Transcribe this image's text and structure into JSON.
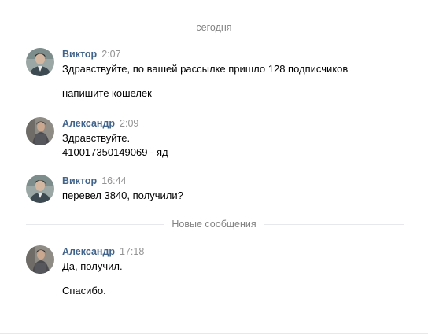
{
  "date_separator": "сегодня",
  "new_messages_separator": "Новые сообщения",
  "messages": [
    {
      "author": "Виктор",
      "time": "2:07",
      "lines": [
        "Здравствуйте, по вашей рассылке пришло 128 подписчиков",
        "напишите кошелек"
      ]
    },
    {
      "author": "Александр",
      "time": "2:09",
      "lines": [
        "Здравствуйте.",
        "410017350149069 - яд"
      ]
    },
    {
      "author": "Виктор",
      "time": "16:44",
      "lines": [
        "перевел 3840, получили?"
      ]
    },
    {
      "author": "Александр",
      "time": "17:18",
      "lines": [
        "Да, получил.",
        "Спасибо."
      ]
    }
  ],
  "colors": {
    "author": "#42648b",
    "time": "#939393",
    "separator_text": "#828282",
    "separator_line": "#e7e8ec"
  }
}
